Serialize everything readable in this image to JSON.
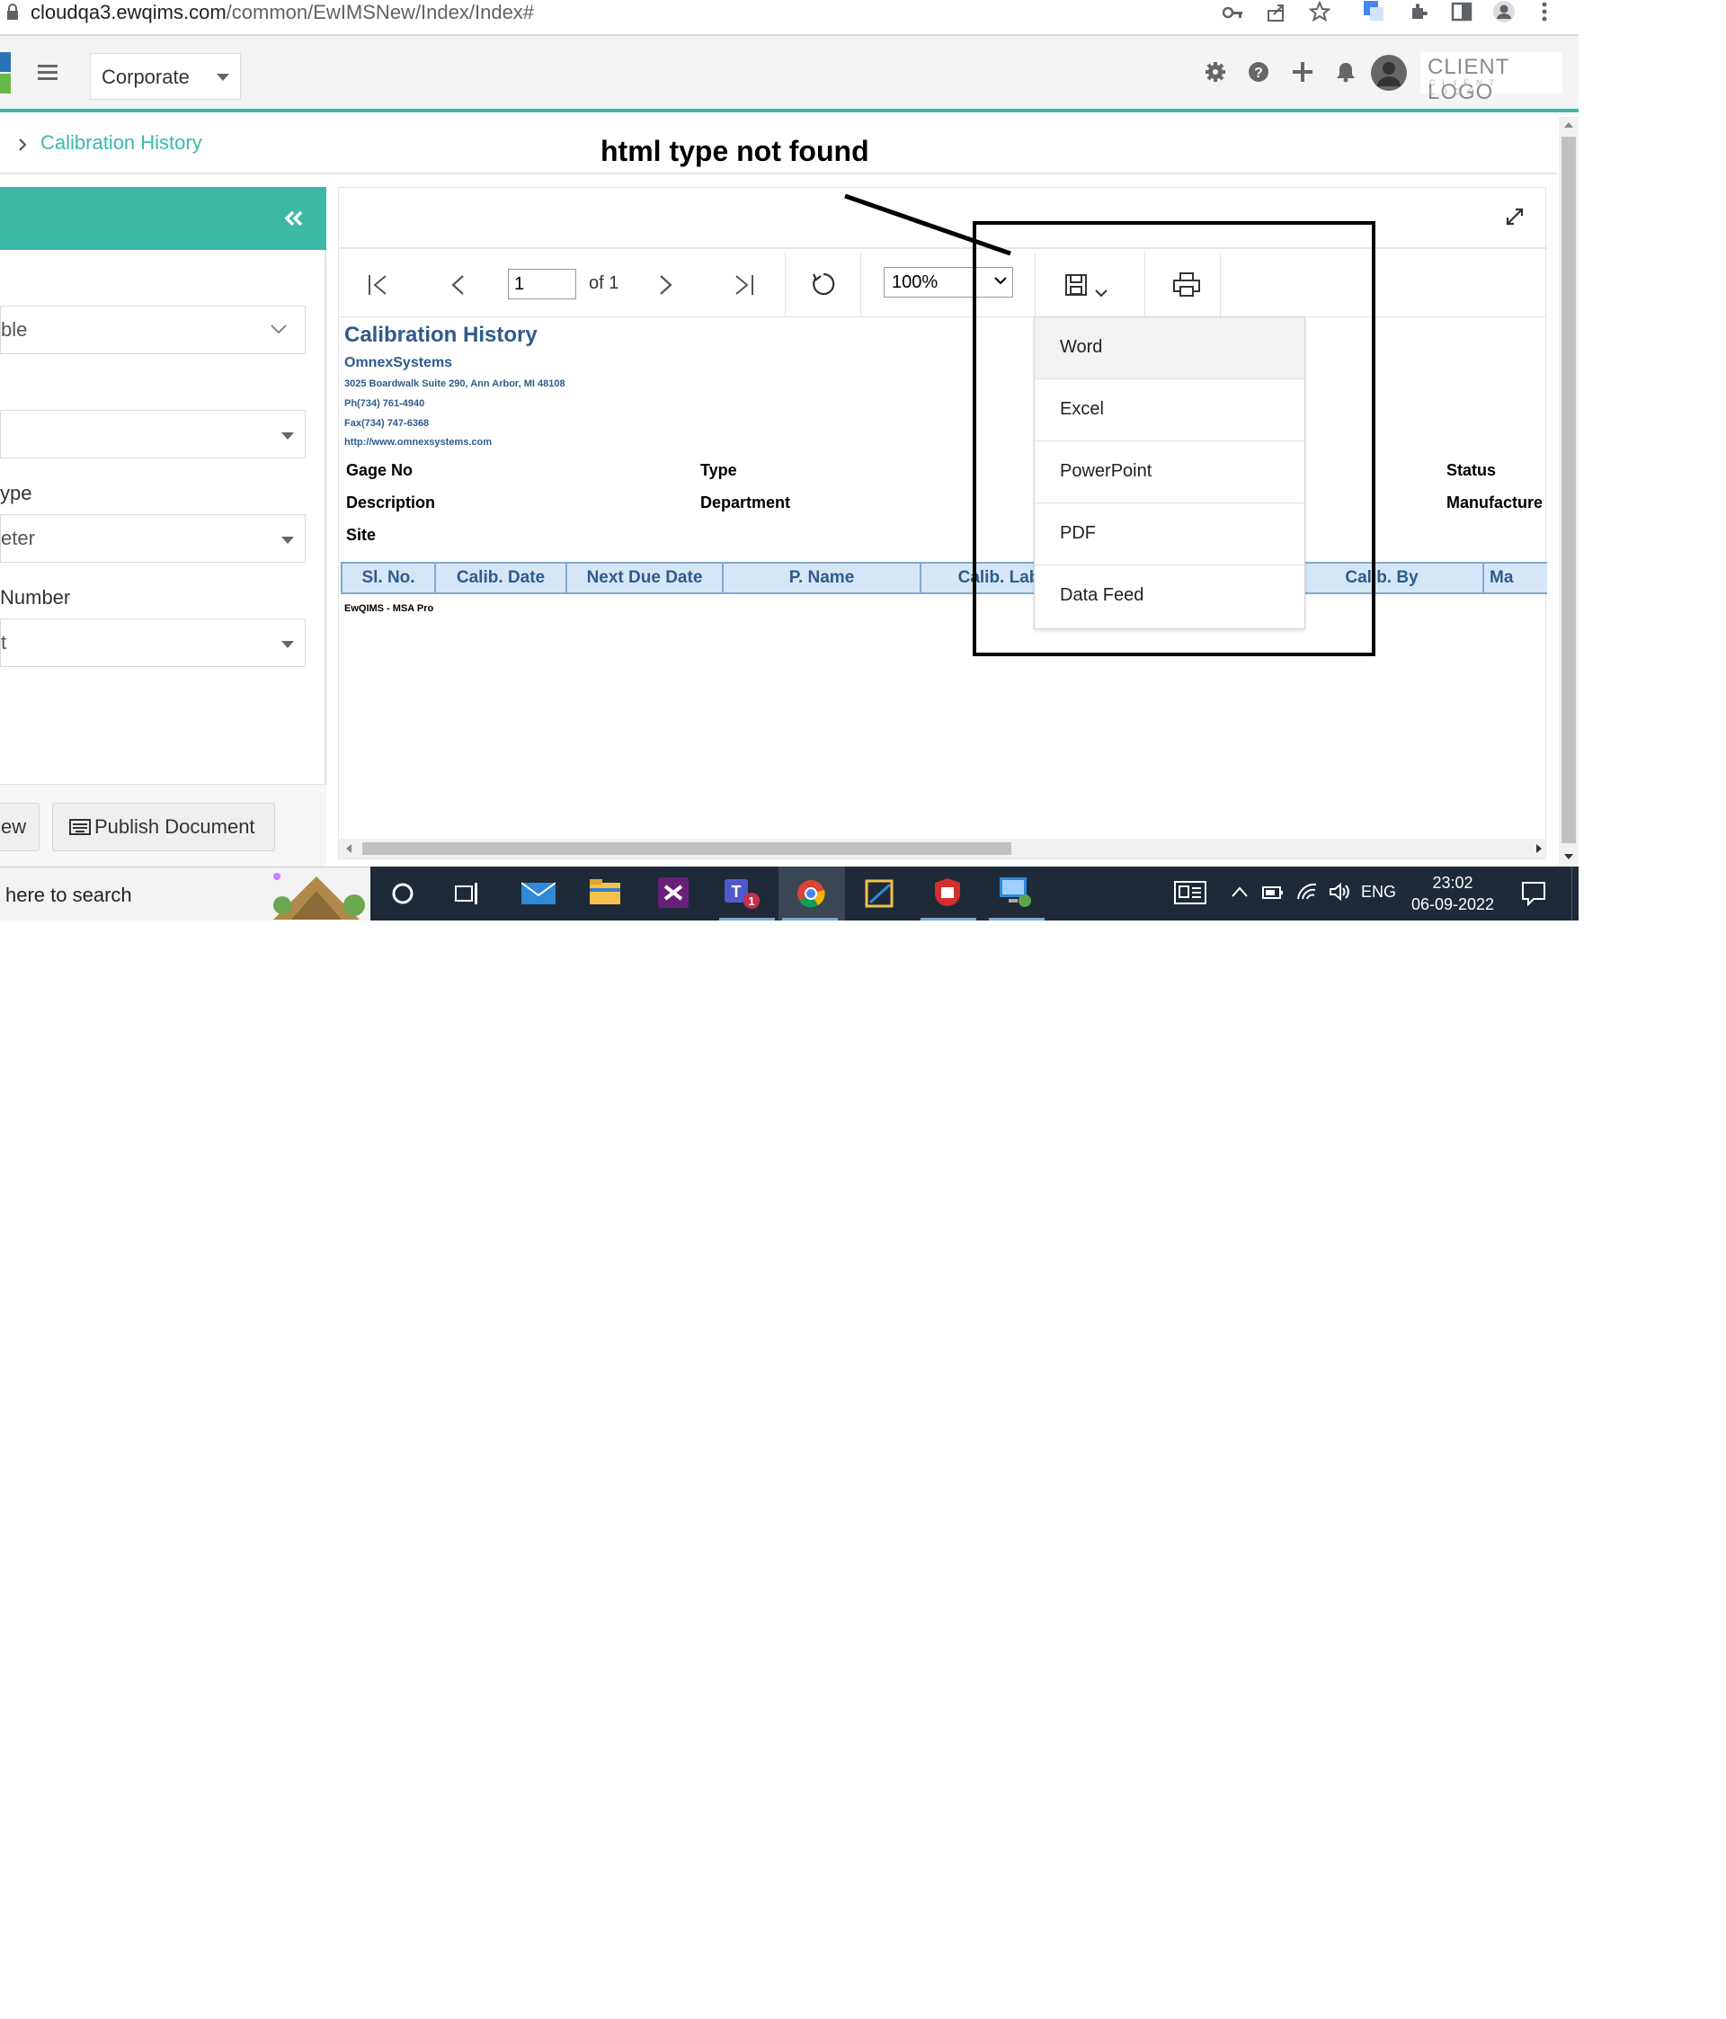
{
  "browser": {
    "url_host": "cloudqa3.ewqims.com",
    "url_path": "/common/EwIMSNew/Index/Index#"
  },
  "header": {
    "site_selector": "Corporate",
    "client_logo": "CLIENT LOGO",
    "client_logo_sub": "CLIENT LOGO",
    "icons": [
      "gear-icon",
      "help-icon",
      "plus-icon",
      "bell-icon",
      "avatar"
    ]
  },
  "breadcrumb": {
    "current": "Calibration History"
  },
  "annotation": {
    "text": "html type not found"
  },
  "left_panel": {
    "fields": [
      {
        "value": "ble"
      },
      {
        "value": ""
      },
      {
        "label": "ype",
        "value": "eter"
      },
      {
        "label": "Number",
        "value": "t"
      }
    ],
    "buttons": {
      "view": "ew",
      "publish": "Publish Document"
    }
  },
  "viewer": {
    "page_input": "1",
    "page_of": "of 1",
    "zoom": "100%"
  },
  "report": {
    "title": "Calibration History",
    "company": "OmnexSystems",
    "address": "3025 Boardwalk Suite 290, Ann Arbor, MI 48108",
    "phone": "Ph(734) 761-4940",
    "fax": "Fax(734) 747-6368",
    "website": "http://www.omnexsystems.com",
    "labels": {
      "gage_no": "Gage No",
      "type": "Type",
      "status": "Status",
      "description": "Description",
      "department": "Department",
      "manufacturer": "Manufacture",
      "site": "Site"
    },
    "columns": [
      "Sl. No.",
      "Calib. Date",
      "Next Due Date",
      "P. Name",
      "Calib. Lab",
      "",
      "Calib. By",
      "Ma"
    ],
    "footer": "EwQIMS - MSA Pro"
  },
  "export_menu": {
    "items": [
      "Word",
      "Excel",
      "PowerPoint",
      "PDF",
      "Data Feed"
    ]
  },
  "taskbar": {
    "search": "here to search",
    "lang": "ENG",
    "time": "23:02",
    "date": "06-09-2022"
  },
  "colors": {
    "accent": "#3cb9a6",
    "report_blue": "#2f5b8a",
    "taskbar": "#1f2a38"
  }
}
